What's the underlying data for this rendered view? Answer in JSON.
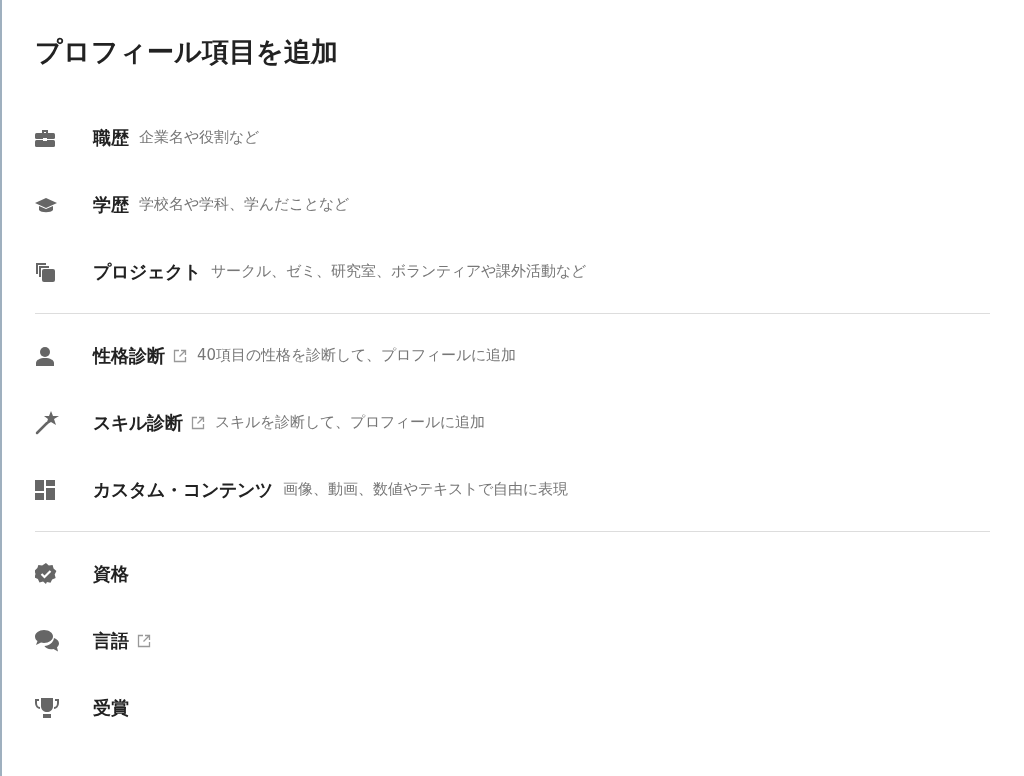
{
  "title": "プロフィール項目を追加",
  "sections": [
    {
      "items": [
        {
          "label": "職歴",
          "external": false,
          "description": "企業名や役割など"
        },
        {
          "label": "学歴",
          "external": false,
          "description": "学校名や学科、学んだことなど"
        },
        {
          "label": "プロジェクト",
          "external": false,
          "description": "サークル、ゼミ、研究室、ボランティアや課外活動など"
        }
      ]
    },
    {
      "items": [
        {
          "label": "性格診断",
          "external": true,
          "description": "40項目の性格を診断して、プロフィールに追加"
        },
        {
          "label": "スキル診断",
          "external": true,
          "description": "スキルを診断して、プロフィールに追加"
        },
        {
          "label": "カスタム・コンテンツ",
          "external": false,
          "description": "画像、動画、数値やテキストで自由に表現"
        }
      ]
    },
    {
      "items": [
        {
          "label": "資格",
          "external": false
        },
        {
          "label": "言語",
          "external": true
        },
        {
          "label": "受賞",
          "external": false
        }
      ]
    }
  ]
}
